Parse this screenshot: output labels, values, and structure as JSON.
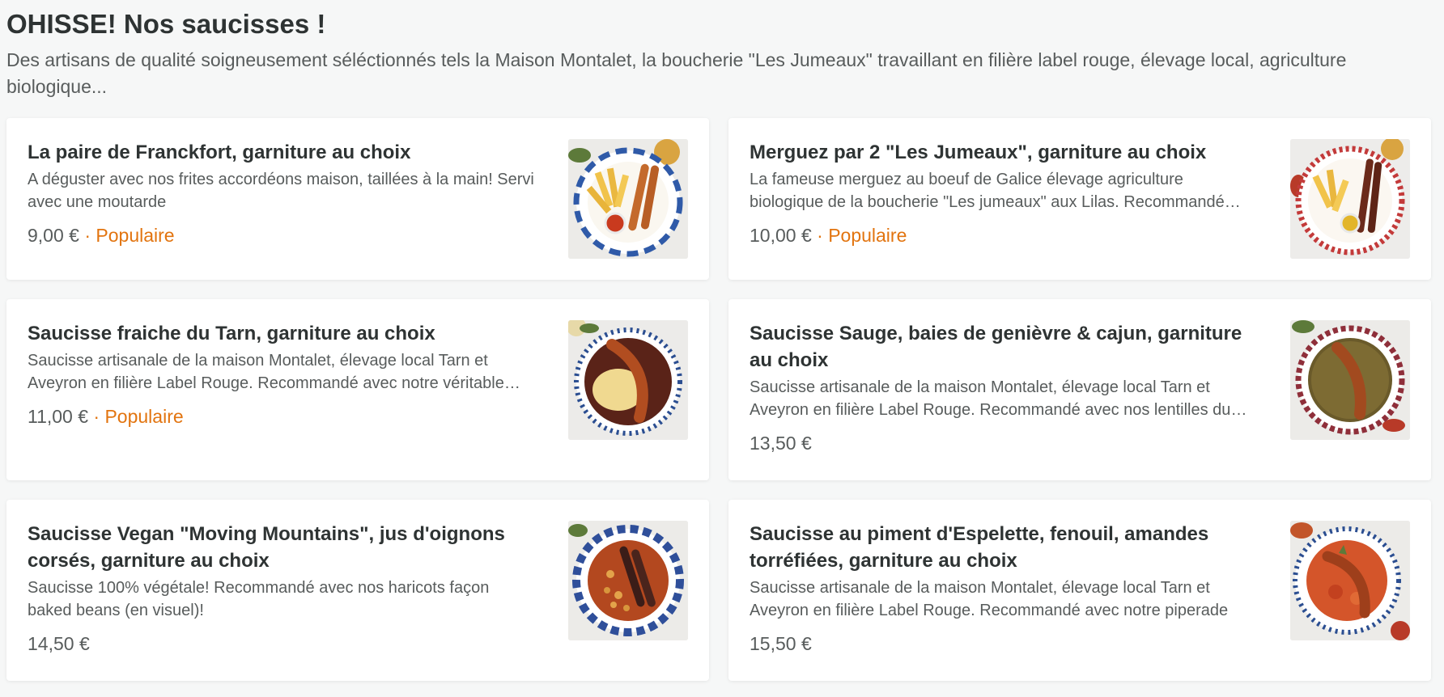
{
  "section": {
    "title": "OHISSE! Nos saucisses !",
    "description": "Des artisans de qualité soigneusement séléctionnés tels la Maison Montalet, la boucherie \"Les Jumeaux\" travaillant en filière label rouge, élevage local, agriculture biologique..."
  },
  "items": [
    {
      "title": "La paire de Franckfort, garniture au choix",
      "description": "A déguster avec nos frites accordéons maison, taillées à la main! Servi avec une moutarde",
      "price": "9,00 €",
      "badge": "· Populaire",
      "image_icon": "franckfort-plate-image"
    },
    {
      "title": "Merguez par 2 \"Les Jumeaux\", garniture au choix",
      "description": "La fameuse merguez au boeuf de Galice élevage agriculture biologique de la boucherie \"Les jumeaux\" aux Lilas. Recommandé avec nos frites",
      "price": "10,00 €",
      "badge": "· Populaire",
      "image_icon": "merguez-plate-image"
    },
    {
      "title": "Saucisse fraiche du Tarn, garniture au choix",
      "description": "Saucisse artisanale de la maison Montalet, élevage local Tarn et Aveyron en filière Label Rouge. Recommandé avec notre véritable aligot",
      "price": "11,00 €",
      "badge": "· Populaire",
      "image_icon": "tarn-sausage-plate-image"
    },
    {
      "title": "Saucisse Sauge, baies de genièvre & cajun, garniture au choix",
      "description": "Saucisse artisanale de la maison Montalet, élevage local Tarn et Aveyron en filière Label Rouge. Recommandé avec nos lentilles du Puy",
      "price": "13,50 €",
      "badge": "",
      "image_icon": "sage-sausage-plate-image"
    },
    {
      "title": "Saucisse Vegan \"Moving Mountains\", jus d'oignons corsés, garniture au choix",
      "description": "Saucisse 100% végétale! Recommandé avec nos haricots façon baked beans (en visuel)!",
      "price": "14,50 €",
      "badge": "",
      "image_icon": "vegan-sausage-plate-image"
    },
    {
      "title": "Saucisse au piment d'Espelette, fenouil, amandes torréfiées, garniture au choix",
      "description": "Saucisse artisanale de la maison Montalet, élevage local Tarn et Aveyron en filière Label Rouge. Recommandé avec notre piperade",
      "price": "15,50 €",
      "badge": "",
      "image_icon": "espelette-sausage-plate-image"
    }
  ],
  "colors": {
    "accent_popular": "#e2740f",
    "text_primary": "#2e3333",
    "text_secondary": "#585c5c",
    "page_background": "#f6f7f7"
  }
}
